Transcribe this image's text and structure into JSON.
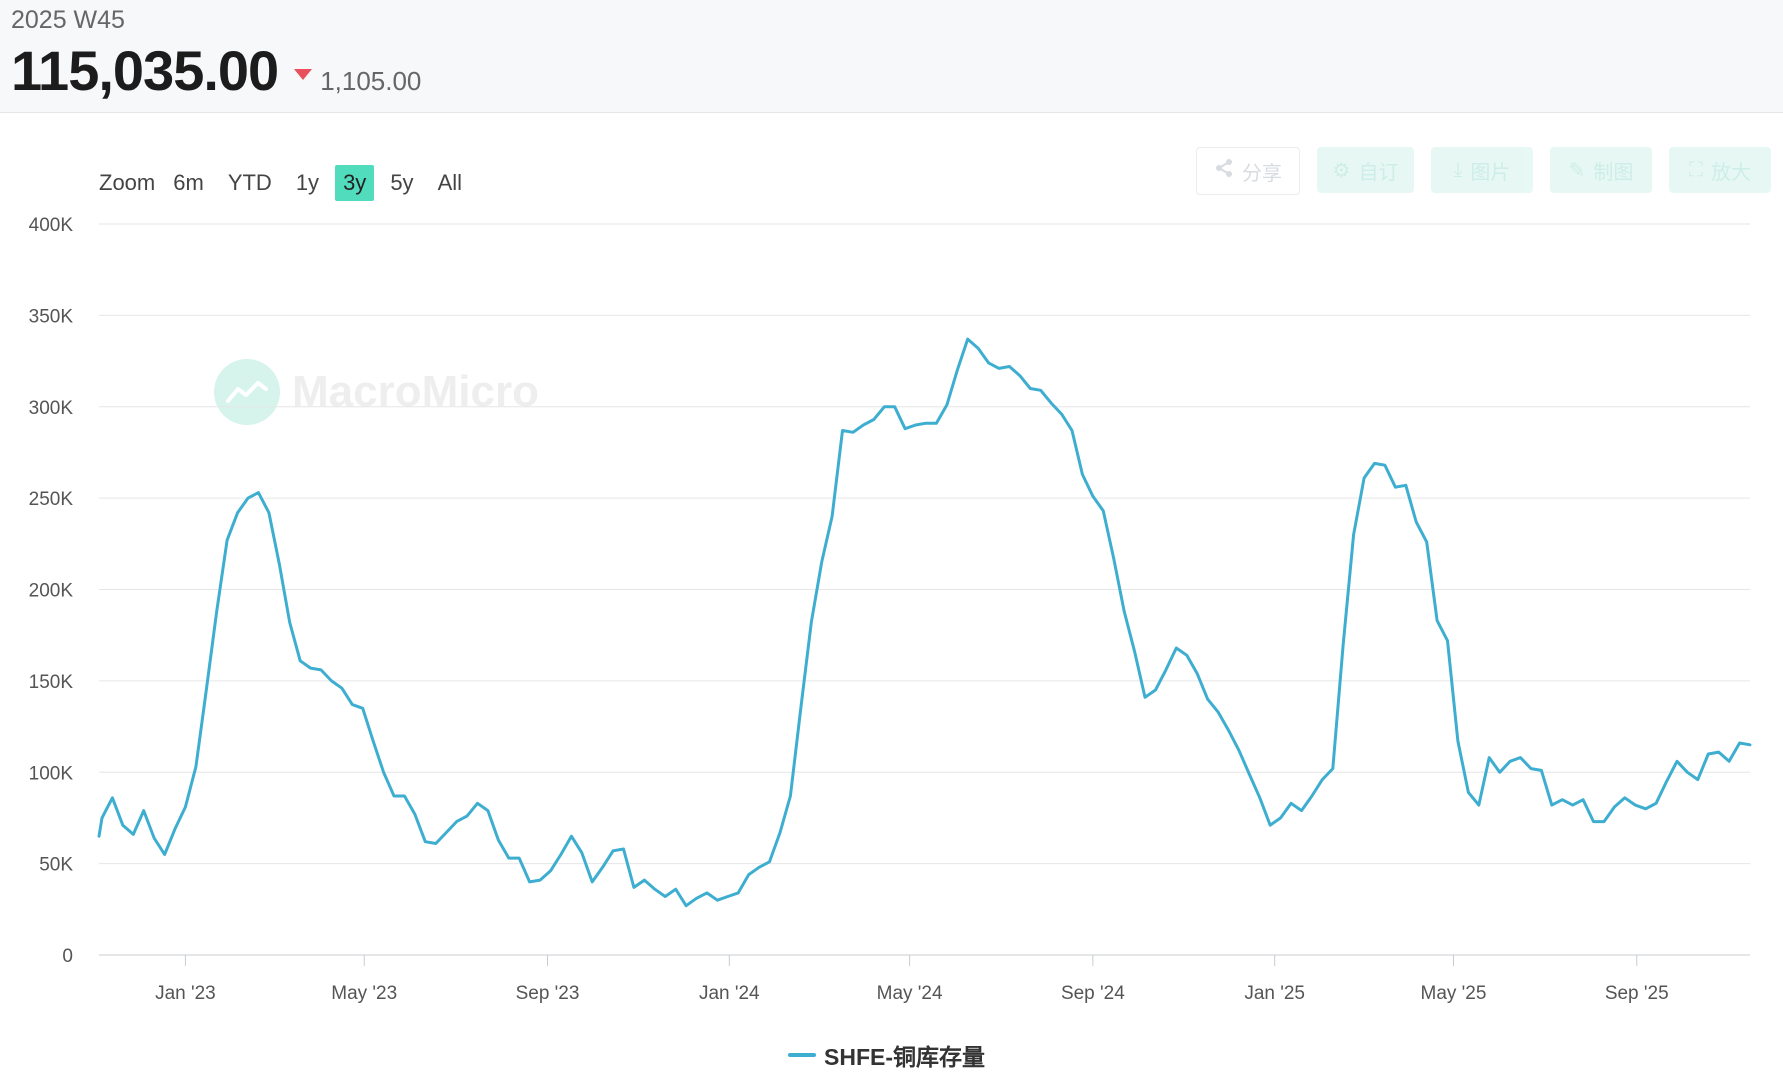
{
  "header": {
    "period": "2025 W45",
    "value": "115,035.00",
    "change": "1,105.00",
    "change_color": "#e8505b"
  },
  "zoom": {
    "label": "Zoom",
    "options": [
      "6m",
      "YTD",
      "1y",
      "3y",
      "5y",
      "All"
    ],
    "active": "3y"
  },
  "toolbar": {
    "share": "分享",
    "subscribe": "自订",
    "download": "图片",
    "draw": "制图",
    "expand": "放大"
  },
  "watermark": {
    "text": "MacroMicro"
  },
  "chart_data": {
    "type": "line",
    "title": "",
    "xlabel": "",
    "ylabel": "",
    "ylim": [
      0,
      400000
    ],
    "y_ticks": [
      0,
      50000,
      100000,
      150000,
      200000,
      250000,
      300000,
      350000,
      400000
    ],
    "y_tick_labels": [
      "0",
      "50K",
      "100K",
      "150K",
      "200K",
      "250K",
      "300K",
      "350K",
      "400K"
    ],
    "x_range": [
      "2022-11-04",
      "2025-11-16"
    ],
    "x_ticks": [
      "2023-01-01",
      "2023-05-01",
      "2023-09-01",
      "2024-01-01",
      "2024-05-01",
      "2024-09-01",
      "2025-01-01",
      "2025-05-01",
      "2025-09-01"
    ],
    "x_tick_labels": [
      "Jan '23",
      "May '23",
      "Sep '23",
      "Jan '24",
      "May '24",
      "Sep '24",
      "Jan '25",
      "May '25",
      "Sep '25"
    ],
    "grid": true,
    "legend": "bottom-center",
    "color": "#3eaed0",
    "series": [
      {
        "name": "SHFE-铜库存量",
        "x": [
          "2022-11-04",
          "2022-11-06",
          "2022-11-13",
          "2022-11-20",
          "2022-11-27",
          "2022-12-04",
          "2022-12-11",
          "2022-12-18",
          "2022-12-25",
          "2023-01-01",
          "2023-01-08",
          "2023-01-15",
          "2023-01-22",
          "2023-01-29",
          "2023-02-05",
          "2023-02-12",
          "2023-02-19",
          "2023-02-26",
          "2023-03-05",
          "2023-03-12",
          "2023-03-19",
          "2023-03-26",
          "2023-04-02",
          "2023-04-09",
          "2023-04-16",
          "2023-04-23",
          "2023-04-30",
          "2023-05-07",
          "2023-05-14",
          "2023-05-21",
          "2023-05-28",
          "2023-06-04",
          "2023-06-11",
          "2023-06-18",
          "2023-06-25",
          "2023-07-02",
          "2023-07-09",
          "2023-07-16",
          "2023-07-23",
          "2023-07-30",
          "2023-08-06",
          "2023-08-13",
          "2023-08-20",
          "2023-08-27",
          "2023-09-03",
          "2023-09-10",
          "2023-09-17",
          "2023-09-24",
          "2023-10-01",
          "2023-10-08",
          "2023-10-15",
          "2023-10-22",
          "2023-10-29",
          "2023-11-05",
          "2023-11-12",
          "2023-11-19",
          "2023-11-26",
          "2023-12-03",
          "2023-12-10",
          "2023-12-17",
          "2023-12-24",
          "2023-12-31",
          "2024-01-07",
          "2024-01-14",
          "2024-01-21",
          "2024-01-28",
          "2024-02-04",
          "2024-02-11",
          "2024-02-18",
          "2024-02-25",
          "2024-03-03",
          "2024-03-10",
          "2024-03-17",
          "2024-03-24",
          "2024-03-31",
          "2024-04-07",
          "2024-04-14",
          "2024-04-21",
          "2024-04-28",
          "2024-05-05",
          "2024-05-12",
          "2024-05-19",
          "2024-05-26",
          "2024-06-02",
          "2024-06-09",
          "2024-06-16",
          "2024-06-23",
          "2024-06-30",
          "2024-07-07",
          "2024-07-14",
          "2024-07-21",
          "2024-07-28",
          "2024-08-04",
          "2024-08-11",
          "2024-08-18",
          "2024-08-25",
          "2024-09-01",
          "2024-09-08",
          "2024-09-15",
          "2024-09-22",
          "2024-09-29",
          "2024-10-06",
          "2024-10-13",
          "2024-10-20",
          "2024-10-27",
          "2024-11-03",
          "2024-11-10",
          "2024-11-17",
          "2024-11-24",
          "2024-12-01",
          "2024-12-08",
          "2024-12-15",
          "2024-12-22",
          "2024-12-29",
          "2025-01-05",
          "2025-01-12",
          "2025-01-19",
          "2025-01-26",
          "2025-02-02",
          "2025-02-09",
          "2025-02-16",
          "2025-02-23",
          "2025-03-02",
          "2025-03-09",
          "2025-03-16",
          "2025-03-23",
          "2025-03-30",
          "2025-04-06",
          "2025-04-13",
          "2025-04-20",
          "2025-04-27",
          "2025-05-04",
          "2025-05-11",
          "2025-05-18",
          "2025-05-25",
          "2025-06-01",
          "2025-06-08",
          "2025-06-15",
          "2025-06-22",
          "2025-06-29",
          "2025-07-06",
          "2025-07-13",
          "2025-07-20",
          "2025-07-27",
          "2025-08-03",
          "2025-08-10",
          "2025-08-17",
          "2025-08-24",
          "2025-08-31",
          "2025-09-07",
          "2025-09-14",
          "2025-09-21",
          "2025-09-28",
          "2025-10-05",
          "2025-10-12",
          "2025-10-19",
          "2025-10-26",
          "2025-11-02",
          "2025-11-09",
          "2025-11-16"
        ],
        "values": [
          65000,
          75000,
          86000,
          71000,
          66000,
          79000,
          64000,
          55000,
          69000,
          81000,
          103000,
          145000,
          188000,
          227000,
          242000,
          250000,
          253000,
          242000,
          214000,
          182000,
          161000,
          157000,
          156000,
          150000,
          146000,
          137000,
          135000,
          117000,
          100000,
          87000,
          87000,
          77000,
          62000,
          61000,
          67000,
          73000,
          76000,
          83000,
          79000,
          63000,
          53000,
          53000,
          40000,
          41000,
          46000,
          55000,
          65000,
          56000,
          40000,
          48000,
          57000,
          58000,
          37000,
          41000,
          36000,
          32000,
          36000,
          27000,
          31000,
          34000,
          30000,
          32000,
          34000,
          44000,
          48000,
          51000,
          67000,
          87000,
          135000,
          182000,
          215000,
          240000,
          287000,
          286000,
          290000,
          293000,
          300000,
          300000,
          288000,
          290000,
          291000,
          291000,
          301000,
          320000,
          337000,
          332000,
          324000,
          321000,
          322000,
          317000,
          310000,
          309000,
          302000,
          296000,
          287000,
          263000,
          251000,
          243000,
          217000,
          188000,
          166000,
          141000,
          145000,
          156000,
          168000,
          164000,
          154000,
          140000,
          133000,
          123000,
          112000,
          99000,
          86000,
          71000,
          75000,
          83000,
          79000,
          87000,
          96000,
          102000,
          170000,
          230000,
          261000,
          269000,
          268000,
          256000,
          257000,
          237000,
          226000,
          183000,
          172000,
          117000,
          89000,
          82000,
          108000,
          100000,
          106000,
          108000,
          102000,
          101000,
          82000,
          85000,
          82000,
          85000,
          73000,
          73000,
          81000,
          86000,
          82000,
          80000,
          83000,
          95000,
          106000,
          100000,
          96000,
          110000,
          111000,
          106000,
          116000,
          115000
        ]
      }
    ]
  }
}
